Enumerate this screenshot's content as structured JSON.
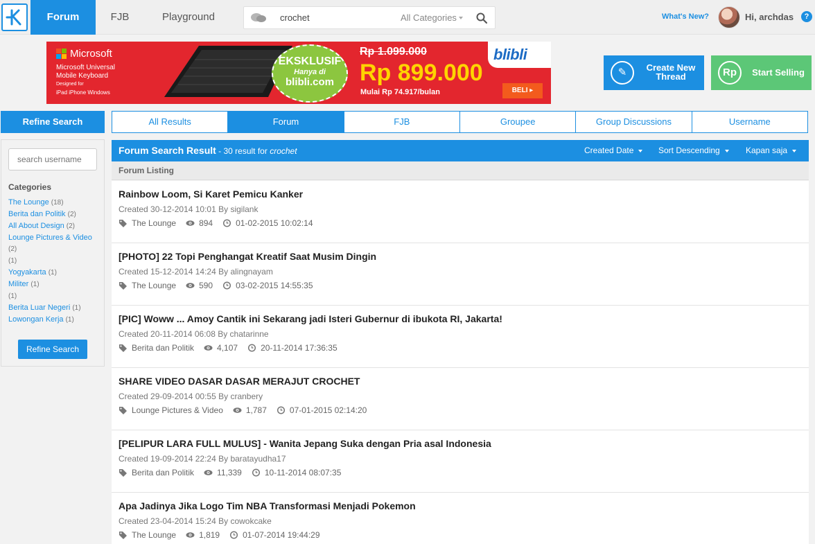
{
  "nav": {
    "tabs": [
      "Forum",
      "FJB",
      "Playground"
    ],
    "search_value": "crochet",
    "category_select": "All Categories",
    "whats_new": "What's New?",
    "greeting": "Hi, archdas"
  },
  "banner": {
    "brand": "Microsoft",
    "product": "Microsoft Universal Mobile Keyboard",
    "designed_for": "Designed for",
    "platforms": "iPad  iPhone     Windows",
    "exclusive_line1": "EKSKLUSIF",
    "exclusive_line2": "Hanya di",
    "exclusive_line3": "blibli.com",
    "old_price": "Rp 1.099.000",
    "new_price": "Rp 899.000",
    "installment": "Mulai Rp 74.917/bulan",
    "store": "blibli",
    "buy_label": "BELI"
  },
  "actions": {
    "create_thread": "Create New Thread",
    "start_selling": "Start Selling",
    "rp_symbol": "Rp"
  },
  "sidebar": {
    "header": "Refine Search",
    "username_placeholder": "search username",
    "categories_title": "Categories",
    "categories": [
      {
        "label": "The Lounge",
        "count": "(18)"
      },
      {
        "label": "Berita dan Politik",
        "count": "(2)"
      },
      {
        "label": "All About Design",
        "count": "(2)"
      },
      {
        "label": "Lounge Pictures & Video",
        "count": "(2)"
      },
      {
        "label": "",
        "count": "(1)"
      },
      {
        "label": "Yogyakarta",
        "count": "(1)"
      },
      {
        "label": "Militer",
        "count": "(1)"
      },
      {
        "label": "",
        "count": "(1)"
      },
      {
        "label": "Berita Luar Negeri",
        "count": "(1)"
      },
      {
        "label": "Lowongan Kerja",
        "count": "(1)"
      }
    ],
    "refine_button": "Refine Search"
  },
  "tabs": [
    "All Results",
    "Forum",
    "FJB",
    "Groupee",
    "Group Discussions",
    "Username"
  ],
  "results": {
    "title": "Forum Search Result",
    "count_text": " - 30 result for ",
    "query": "crochet",
    "sort_date": "Created Date",
    "sort_order": "Sort Descending",
    "time_filter": "Kapan saja",
    "listing_label": "Forum Listing",
    "items": [
      {
        "title": "Rainbow Loom, Si Karet Pemicu Kanker",
        "created": "Created 30-12-2014 10:01 By sigilank",
        "category": "The Lounge",
        "views": "894",
        "last": "01-02-2015 10:02:14"
      },
      {
        "title": "[PHOTO] 22 Topi Penghangat Kreatif Saat Musim Dingin",
        "created": "Created 15-12-2014 14:24 By alingnayam",
        "category": "The Lounge",
        "views": "590",
        "last": "03-02-2015 14:55:35"
      },
      {
        "title": "[PIC] Woww ... Amoy Cantik ini Sekarang jadi Isteri Gubernur di ibukota RI, Jakarta!",
        "created": "Created 20-11-2014 06:08 By chatarinne",
        "category": "Berita dan Politik",
        "views": "4,107",
        "last": "20-11-2014 17:36:35"
      },
      {
        "title": "SHARE VIDEO DASAR DASAR MERAJUT CROCHET",
        "created": "Created 29-09-2014 00:55 By cranbery",
        "category": "Lounge Pictures & Video",
        "views": "1,787",
        "last": "07-01-2015 02:14:20"
      },
      {
        "title": "[PELIPUR LARA FULL MULUS] - Wanita Jepang Suka dengan Pria asal Indonesia",
        "created": "Created 19-09-2014 22:24 By baratayudha17",
        "category": "Berita dan Politik",
        "views": "11,339",
        "last": "10-11-2014 08:07:35"
      },
      {
        "title": "Apa Jadinya Jika Logo Tim NBA Transformasi Menjadi Pokemon",
        "created": "Created 23-04-2014 15:24 By cowokcake",
        "category": "The Lounge",
        "views": "1,819",
        "last": "01-07-2014 19:44:29"
      }
    ]
  },
  "colors": {
    "primary": "#1c8fe1",
    "sell_green": "#5cc777",
    "banner_red": "#e3262e"
  }
}
